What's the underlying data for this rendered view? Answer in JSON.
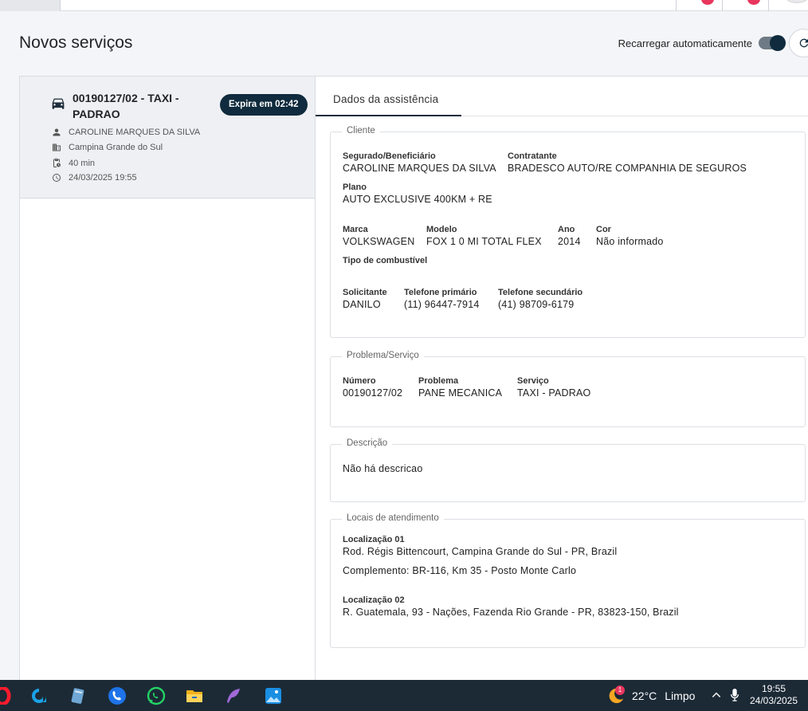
{
  "page": {
    "title": "Novos serviços"
  },
  "reload": {
    "label": "Recarregar automaticamente",
    "enabled": true
  },
  "service_card": {
    "title": "00190127/02 - TAXI - PADRAO",
    "badge": "Expira em 02:42",
    "client": "CAROLINE MARQUES DA SILVA",
    "city": "Campina Grande do Sul",
    "duration": "40 min",
    "datetime": "24/03/2025 19:55"
  },
  "tabs": {
    "active": "Dados da assistência"
  },
  "cliente": {
    "legend": "Cliente",
    "segurado_label": "Segurado/Beneficiário",
    "segurado_value": "CAROLINE MARQUES DA SILVA",
    "contratante_label": "Contratante",
    "contratante_value": "BRADESCO AUTO/RE COMPANHIA DE SEGUROS",
    "plano_label": "Plano",
    "plano_value": "AUTO EXCLUSIVE 400KM + RE",
    "marca_label": "Marca",
    "marca_value": "VOLKSWAGEN",
    "modelo_label": "Modelo",
    "modelo_value": "FOX 1 0 MI TOTAL FLEX",
    "ano_label": "Ano",
    "ano_value": "2014",
    "cor_label": "Cor",
    "cor_value": "Não informado",
    "combustivel_label": "Tipo de combustível",
    "solicitante_label": "Solicitante",
    "solicitante_value": "DANILO",
    "tel1_label": "Telefone primário",
    "tel1_value": "(11) 96447-7914",
    "tel2_label": "Telefone secundário",
    "tel2_value": "(41) 98709-6179"
  },
  "problema": {
    "legend": "Problema/Serviço",
    "numero_label": "Número",
    "numero_value": "00190127/02",
    "problema_label": "Problema",
    "problema_value": "PANE MECANICA",
    "servico_label": "Serviço",
    "servico_value": "TAXI - PADRAO"
  },
  "descricao": {
    "legend": "Descrição",
    "value": "Não há descricao"
  },
  "locais": {
    "legend": "Locais de atendimento",
    "loc1_label": "Localização 01",
    "loc1_value": "Rod. Régis Bittencourt, Campina Grande do Sul - PR, Brazil",
    "loc1_complemento": "Complemento: BR-116, Km 35 - Posto Monte Carlo",
    "loc2_label": "Localização 02",
    "loc2_value": "R. Guatemala, 93 - Nações, Fazenda Rio Grande - PR, 83823-150, Brazil"
  },
  "taskbar": {
    "weather_temp": "22°C",
    "weather_text": "Limpo",
    "weather_badge": "1",
    "time": "19:55",
    "date": "24/03/2025"
  },
  "colors": {
    "accent": "#0f2b3d",
    "notification": "#e8365d"
  }
}
